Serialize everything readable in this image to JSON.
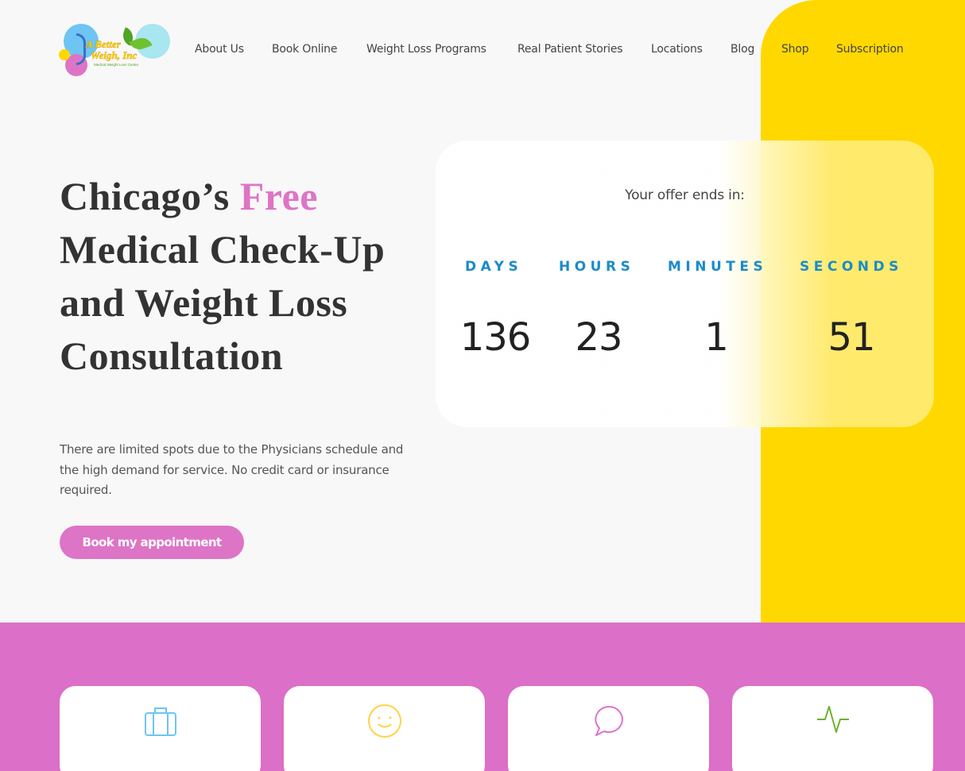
{
  "brand": {
    "logo_line1": "A Better",
    "logo_line2": "Weigh, Inc",
    "logo_tagline": "Medical Weight Loss Center"
  },
  "nav": [
    {
      "label": "About Us"
    },
    {
      "label": "Book Online"
    },
    {
      "label": "Weight Loss Programs"
    },
    {
      "label": "Real Patient Stories"
    },
    {
      "label": "Locations"
    },
    {
      "label": "Blog"
    },
    {
      "label": "Shop"
    },
    {
      "label": "Subscription"
    }
  ],
  "hero": {
    "title_pre": "Chicago’s ",
    "title_highlight": "Free",
    "title_rest": " Medical Check-Up and Weight Loss Consultation",
    "description": "There are limited spots due to the Physicians schedule and the high demand for service. No credit card or insurance required.",
    "cta_label": "Book my appointment"
  },
  "countdown": {
    "heading": "Your offer ends in:",
    "units": [
      {
        "label": "DAYS",
        "value": "136"
      },
      {
        "label": "HOURS",
        "value": "23"
      },
      {
        "label": "MINUTES",
        "value": "1"
      },
      {
        "label": "SECONDS",
        "value": "51"
      }
    ]
  },
  "feature_cards": [
    {
      "icon": "briefcase-icon"
    },
    {
      "icon": "smiley-icon"
    },
    {
      "icon": "chat-bubble-icon"
    },
    {
      "icon": "heartbeat-icon"
    }
  ],
  "colors": {
    "accent_pink": "#de74c6",
    "accent_yellow": "#ffd800",
    "accent_blue": "#1a8bc9",
    "accent_green": "#6fc131"
  }
}
